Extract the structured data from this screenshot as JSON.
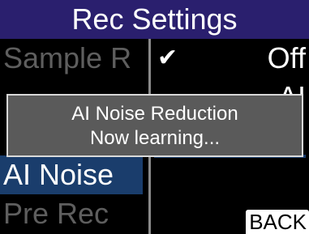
{
  "header": {
    "title": "Rec Settings"
  },
  "menu": {
    "items": [
      {
        "label": "Sample R"
      },
      {
        "label": "AI Noise"
      },
      {
        "label": "Pre Rec"
      }
    ]
  },
  "options": {
    "current": {
      "label": "Off",
      "checked": true
    },
    "partial_label": "AI"
  },
  "footer": {
    "back_label": "BACK"
  },
  "dialog": {
    "line1": "AI Noise Reduction",
    "line2": "Now learning..."
  },
  "colors": {
    "title_bar": "#2a1f6e",
    "selection": "#1a3d6c",
    "dialog_bg": "#5a5a5a"
  }
}
